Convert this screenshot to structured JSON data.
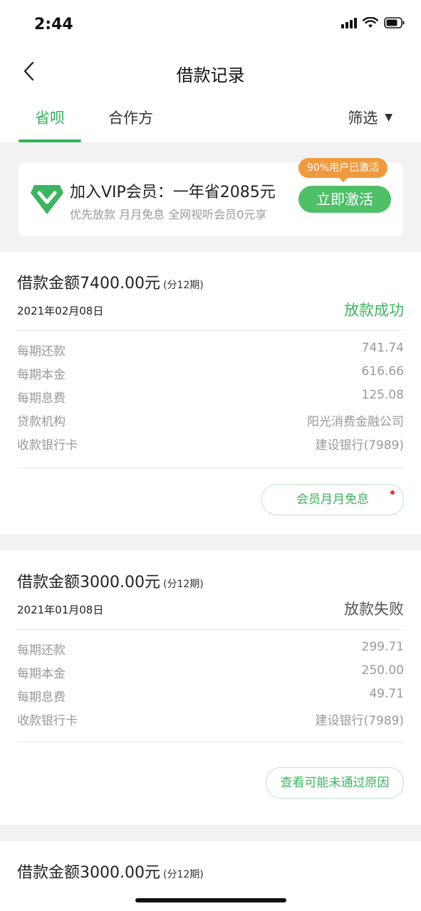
{
  "status_bar": {
    "time": "2:44"
  },
  "nav": {
    "title": "借款记录"
  },
  "tabs": {
    "items": [
      {
        "label": "省呗"
      },
      {
        "label": "合作方"
      }
    ],
    "filter_label": "筛选"
  },
  "promo": {
    "title": "加入VIP会员：一年省2085元",
    "subtitle": "优先放款 月月免息 全网视听会员0元享",
    "badge": "90%用户已激活",
    "button": "立即激活"
  },
  "loans": [
    {
      "amount": "借款金额7400.00元",
      "period": "(分12期)",
      "date": "2021年02月08日",
      "status": "放款成功",
      "rows": [
        {
          "label": "每期还款",
          "value": "741.74"
        },
        {
          "label": "每期本金",
          "value": "616.66"
        },
        {
          "label": "每期息费",
          "value": "125.08"
        },
        {
          "label": "贷款机构",
          "value": "阳光消费金融公司"
        },
        {
          "label": "收款银行卡",
          "value": "建设银行(7989)"
        }
      ],
      "button": "会员月月免息"
    },
    {
      "amount": "借款金额3000.00元",
      "period": "(分12期)",
      "date": "2021年01月08日",
      "status": "放款失败",
      "rows": [
        {
          "label": "每期还款",
          "value": "299.71"
        },
        {
          "label": "每期本金",
          "value": "250.00"
        },
        {
          "label": "每期息费",
          "value": "49.71"
        },
        {
          "label": "收款银行卡",
          "value": "建设银行(7989)"
        }
      ],
      "button": "查看可能未通过原因"
    },
    {
      "amount": "借款金额3000.00元",
      "period": "(分12期)"
    }
  ],
  "colors": {
    "accent": "#2fb55b",
    "badge": "#f09a3e",
    "fail_text": "#555555"
  }
}
